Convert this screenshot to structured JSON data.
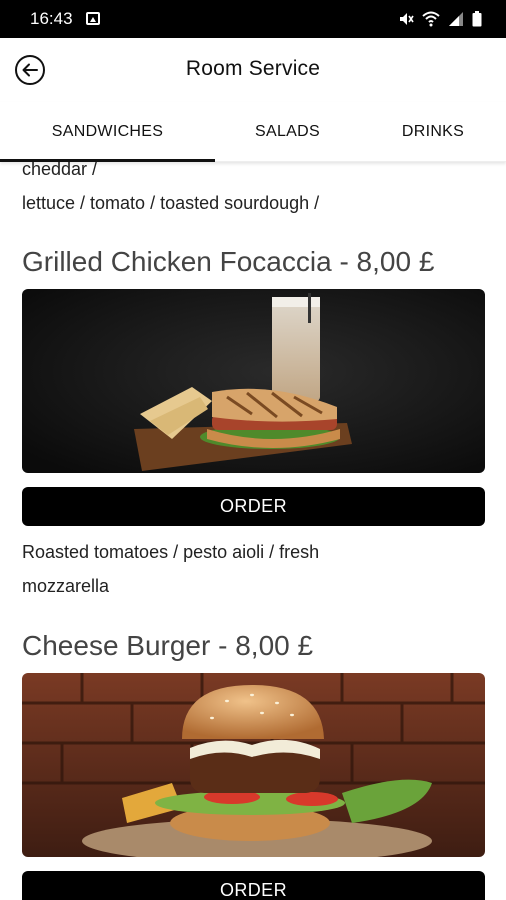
{
  "status_bar": {
    "time": "16:43"
  },
  "header": {
    "title": "Room Service"
  },
  "tabs": [
    {
      "label": "SANDWICHES",
      "active": true
    },
    {
      "label": "SALADS",
      "active": false
    },
    {
      "label": "DRINKS",
      "active": false
    }
  ],
  "previous_item": {
    "description_lines": [
      "cheddar /",
      "lettuce / tomato / toasted sourdough /"
    ]
  },
  "items": [
    {
      "title": "Grilled Chicken Focaccia - 8,00 £",
      "order_label": "ORDER",
      "description_lines": [
        "Roasted tomatoes / pesto aioli / fresh",
        "mozzarella"
      ]
    },
    {
      "title": "Cheese Burger - 8,00 £",
      "order_label": "ORDER"
    }
  ],
  "colors": {
    "accent": "#000000",
    "status_bar": "#000000",
    "background": "#ffffff"
  }
}
